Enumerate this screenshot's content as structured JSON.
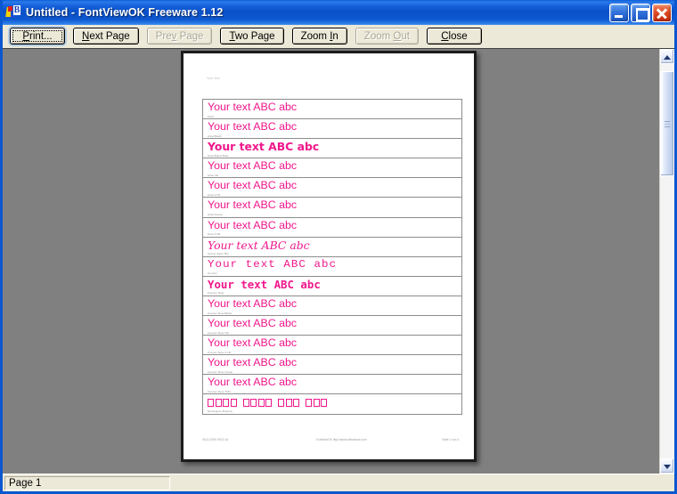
{
  "window": {
    "title": "Untitled - FontViewOK Freeware 1.12",
    "icon": "app-icon",
    "icon_letter": "B",
    "controls": {
      "minimize": "Minimize",
      "maximize": "Maximize",
      "close": "Close"
    },
    "titlebar_color": "#0a57d0",
    "close_color": "#e04b22"
  },
  "toolbar": {
    "buttons": [
      {
        "label": "Print...",
        "accel": "P",
        "before": "",
        "after": "rint...",
        "disabled": false,
        "focused": true,
        "name": "print-button"
      },
      {
        "label": "Next Page",
        "accel": "N",
        "before": "",
        "after": "ext Page",
        "disabled": false,
        "focused": false,
        "name": "next-page-button"
      },
      {
        "label": "Prev Page",
        "accel": "v",
        "before": "Pre",
        "after": " Page",
        "disabled": true,
        "focused": false,
        "name": "prev-page-button"
      },
      {
        "label": "Two Page",
        "accel": "T",
        "before": "",
        "after": "wo Page",
        "disabled": false,
        "focused": false,
        "name": "two-page-button"
      },
      {
        "label": "Zoom In",
        "accel": "I",
        "before": "Zoom ",
        "after": "n",
        "disabled": false,
        "focused": false,
        "name": "zoom-in-button"
      },
      {
        "label": "Zoom Out",
        "accel": "O",
        "before": "Zoom ",
        "after": "ut",
        "disabled": true,
        "focused": false,
        "name": "zoom-out-button"
      },
      {
        "label": "Close",
        "accel": "C",
        "before": "",
        "after": "lose",
        "disabled": false,
        "focused": false,
        "name": "close-button"
      }
    ]
  },
  "preview": {
    "page_header": "Your text",
    "sample_color": "#f0178c",
    "rows": [
      {
        "sample": "Your text ABC abc",
        "font": "Arial",
        "style": "s-sans"
      },
      {
        "sample": "Your text ABC abc",
        "font": "Arial Black",
        "style": "s-sans"
      },
      {
        "sample": "Your text ABC abc",
        "font": "Arial Black Bold",
        "style": "s-dsans s-bold"
      },
      {
        "sample": "Your text ABC abc",
        "font": "Arial CE",
        "style": "s-sans"
      },
      {
        "sample": "Your text ABC abc",
        "font": "Arial CYR",
        "style": "s-sans"
      },
      {
        "sample": "Your text ABC abc",
        "font": "Arial Greek",
        "style": "s-sans"
      },
      {
        "sample": "Your text ABC abc",
        "font": "Arial TUR",
        "style": "s-sans"
      },
      {
        "sample": "Your text ABC abc",
        "font": "Comic Sans MS",
        "style": "s-dserif s-ital"
      },
      {
        "sample": "Your text ABC abc",
        "font": "Courier",
        "style": "s-mono s-wide"
      },
      {
        "sample": "Your text ABC abc",
        "font": "Courier New",
        "style": "s-dmono s-bold"
      },
      {
        "sample": "Your text ABC abc",
        "font": "Courier New Baltic",
        "style": "s-sans"
      },
      {
        "sample": "Your text ABC abc",
        "font": "Courier New CE",
        "style": "s-sans"
      },
      {
        "sample": "Your text ABC abc",
        "font": "Courier New CYR",
        "style": "s-sans"
      },
      {
        "sample": "Your text ABC abc",
        "font": "Courier New Greek",
        "style": "s-sans"
      },
      {
        "sample": "Your text ABC abc",
        "font": "Courier New TUR",
        "style": "s-sans"
      },
      {
        "sample": "□□□□ □□□□ □□□ □□□",
        "font": "Estrangelo Edessa",
        "style": "s-tofu"
      }
    ],
    "footer": {
      "left": "05.02.2009 09:21:16",
      "middle": "FontViewOK http://www.softwareok.com",
      "right": "Seite 1 von 4"
    }
  },
  "scrollbar": {
    "up_arrow": "scroll-up-arrow",
    "down_arrow": "scroll-down-arrow"
  },
  "statusbar": {
    "text": "Page 1"
  }
}
